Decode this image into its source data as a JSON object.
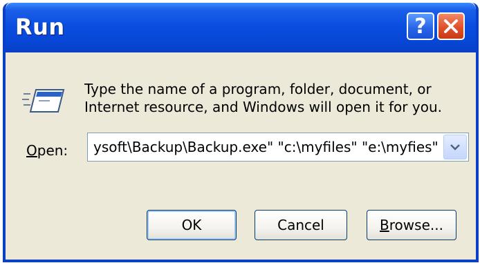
{
  "window": {
    "title": "Run",
    "help_symbol": "?",
    "close_icon": "close-icon"
  },
  "dialog": {
    "instructions": "Type the name of a program, folder, document, or\nInternet resource, and Windows will open it for you.",
    "icon": "run-icon",
    "open_label_mnemonic": "O",
    "open_label_rest": "pen:",
    "open_value": "ysoft\\Backup\\Backup.exe\" \"c:\\myfiles\" \"e:\\myfies\""
  },
  "buttons": {
    "ok": "OK",
    "cancel": "Cancel",
    "browse_mnemonic": "B",
    "browse_rest": "rowse..."
  },
  "colors": {
    "titlebar": "#0a4fe0",
    "close_button": "#e0502a",
    "dialog_background": "#ece9d8"
  }
}
